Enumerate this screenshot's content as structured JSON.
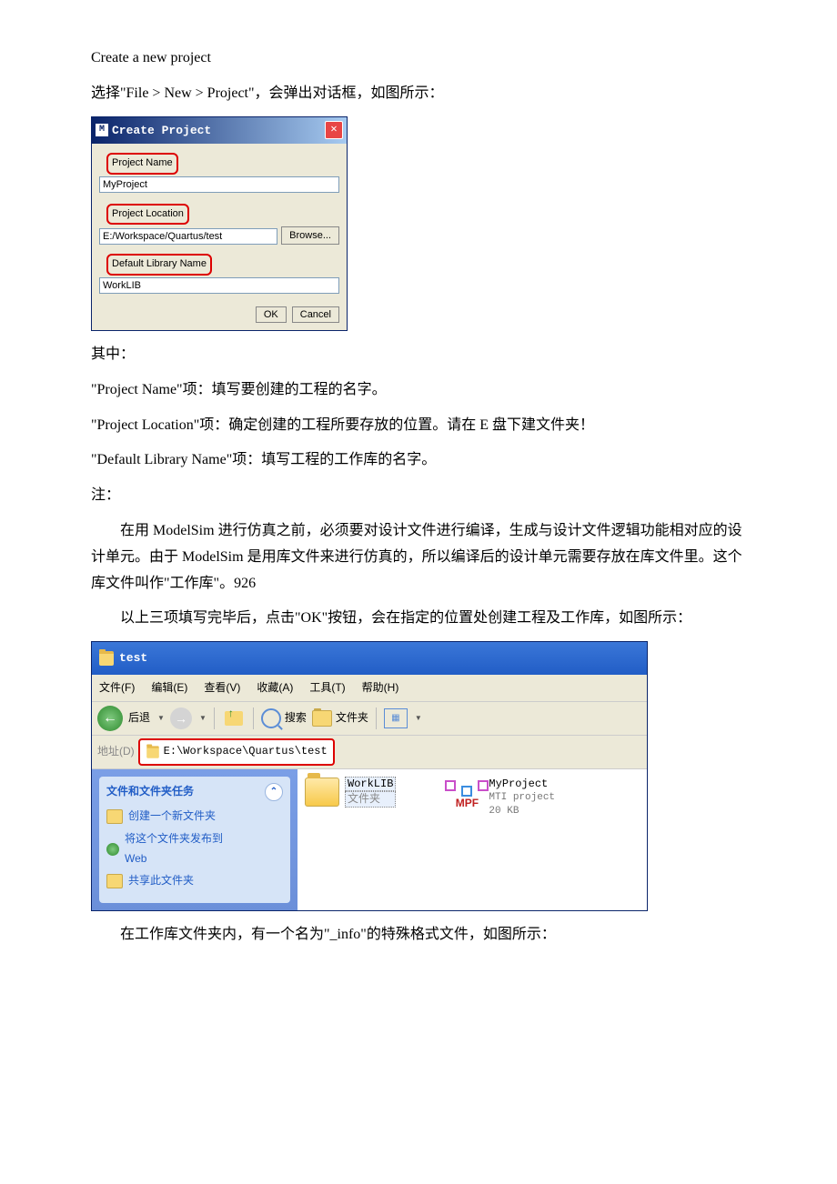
{
  "intro": {
    "heading": "Create a new project",
    "line1": "选择\"File > New > Project\"，会弹出对话框，如图所示："
  },
  "dialog": {
    "title": "Create Project",
    "project_name_label": "Project Name",
    "project_name_value": "MyProject",
    "project_location_label": "Project Location",
    "project_location_value": "E:/Workspace/Quartus/test",
    "browse_label": "Browse...",
    "default_lib_label": "Default Library Name",
    "default_lib_value": "WorkLIB",
    "ok_label": "OK",
    "cancel_label": "Cancel"
  },
  "body": {
    "l_qizhong": "其中：",
    "l_projname": "\"Project Name\"项：填写要创建的工程的名字。",
    "l_projloc": "\"Project Location\"项：确定创建的工程所要存放的位置。请在 E 盘下建文件夹！",
    "l_deflib": "\"Default Library Name\"项：填写工程的工作库的名字。",
    "l_note": "注：",
    "l_para1": "在用 ModelSim 进行仿真之前，必须要对设计文件进行编译，生成与设计文件逻辑功能相对应的设计单元。由于 ModelSim 是用库文件来进行仿真的，所以编译后的设计单元需要存放在库文件里。这个库文件叫作\"工作库\"。926",
    "l_para2": "以上三项填写完毕后，点击\"OK\"按钮，会在指定的位置处创建工程及工作库，如图所示："
  },
  "explorer": {
    "title": "test",
    "menu": {
      "file": "文件(F)",
      "edit": "编辑(E)",
      "view": "查看(V)",
      "fav": "收藏(A)",
      "tools": "工具(T)",
      "help": "帮助(H)"
    },
    "toolbar": {
      "back": "后退",
      "search": "搜索",
      "folders": "文件夹"
    },
    "addr_label": "地址(D)",
    "addr_value": "E:\\Workspace\\Quartus\\test",
    "side": {
      "panel_title": "文件和文件夹任务",
      "item1": "创建一个新文件夹",
      "item2a": "将这个文件夹发布到",
      "item2b": "Web",
      "item3": "共享此文件夹"
    },
    "files": {
      "f1_name": "WorkLIB",
      "f1_sub": "文件夹",
      "f2_name": "MyProject",
      "f2_sub": "MTI project",
      "f2_size": "20 KB",
      "f2_icon_label": "MPF"
    }
  },
  "tail": {
    "line": "在工作库文件夹内，有一个名为\"_info\"的特殊格式文件，如图所示："
  }
}
